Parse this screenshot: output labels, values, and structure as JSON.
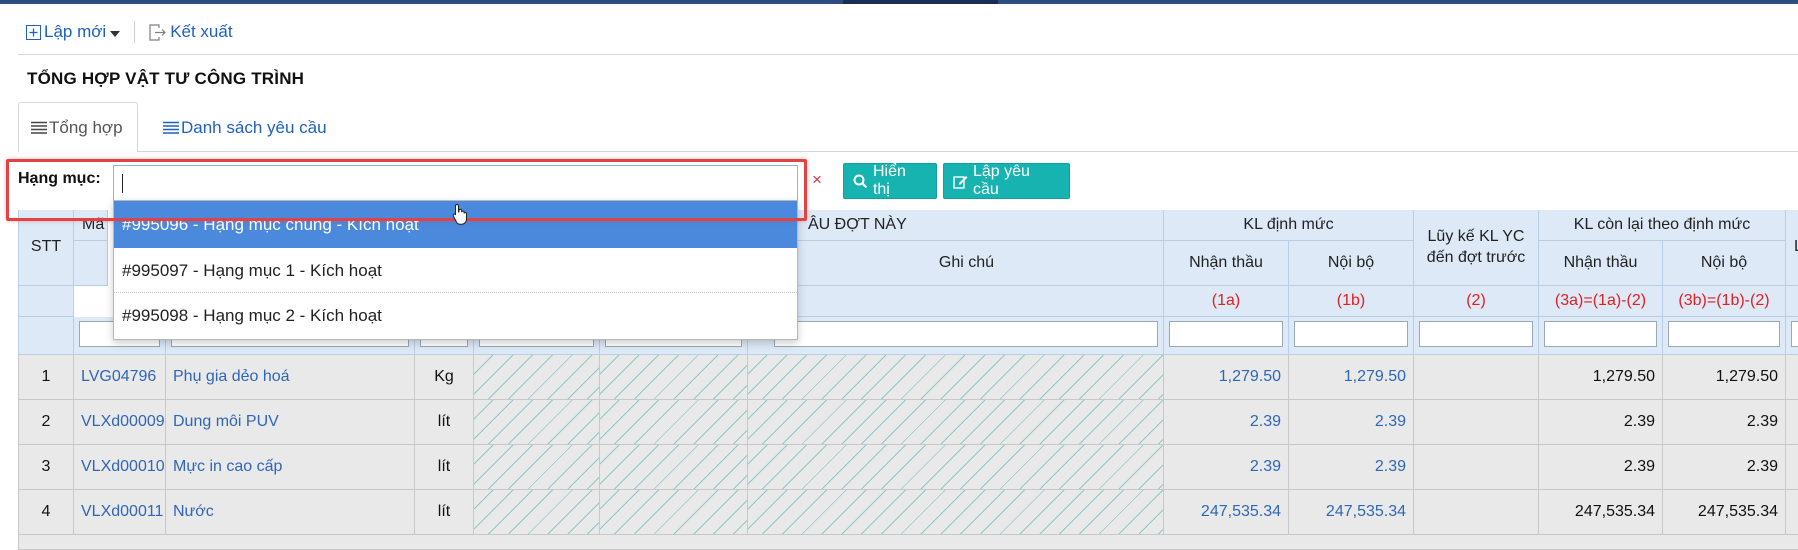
{
  "toolbar": {
    "new_label": "Lập mới",
    "export_label": "Kết xuất"
  },
  "page_title": "TỔNG HỢP VẬT TƯ CÔNG TRÌNH",
  "tabs": [
    {
      "label": "Tổng hợp"
    },
    {
      "label": "Danh sách yêu cầu"
    }
  ],
  "filter": {
    "label": "Hạng mục:",
    "value": "",
    "clear_symbol": "×"
  },
  "buttons": {
    "show": "Hiển thị",
    "create_request": "Lập yêu cầu"
  },
  "dropdown": {
    "options": [
      "#995096 - Hạng mục chung - Kích hoạt",
      "#995097 - Hạng mục 1 - Kích hoạt",
      "#995098 - Hạng mục 2 - Kích hoạt"
    ],
    "selected_index": 0
  },
  "table": {
    "headers": {
      "stt": "STT",
      "ma": "Mã",
      "this_round": "ÂU ĐỢT NÀY",
      "ghi_chu": "Ghi chú",
      "kl_dinh_muc": "KL định mức",
      "nhan_thau": "Nhận thầu",
      "noi_bo": "Nội bộ",
      "luy_ke": "Lũy kế KL YC đến đợt trước",
      "kl_con_lai": "KL còn lại theo định mức",
      "nhan_thau_2": "Nhận thầu",
      "noi_bo_2": "Nội bộ",
      "luy_partial": "Lũ"
    },
    "formulas": {
      "f1a": "(1a)",
      "f1b": "(1b)",
      "f2": "(2)",
      "f3a": "(3a)=(1a)-(2)",
      "f3b": "(3b)=(1b)-(2)"
    },
    "rows": [
      {
        "stt": "1",
        "code": "LVG04796",
        "name": "Phụ gia dẻo hoá",
        "unit": "Kg",
        "nt": "1,279.50",
        "nb": "1,279.50",
        "cl_nt": "1,279.50",
        "cl_nb": "1,279.50"
      },
      {
        "stt": "2",
        "code": "VLXd00009",
        "name": "Dung môi PUV",
        "unit": "lít",
        "nt": "2.39",
        "nb": "2.39",
        "cl_nt": "2.39",
        "cl_nb": "2.39"
      },
      {
        "stt": "3",
        "code": "VLXd00010",
        "name": "Mực in cao cấp",
        "unit": "lít",
        "nt": "2.39",
        "nb": "2.39",
        "cl_nt": "2.39",
        "cl_nb": "2.39"
      },
      {
        "stt": "4",
        "code": "VLXd00011",
        "name": "Nước",
        "unit": "lít",
        "nt": "247,535.34",
        "nb": "247,535.34",
        "cl_nt": "247,535.34",
        "cl_nb": "247,535.34"
      }
    ]
  },
  "colors": {
    "accent": "#17b3b0",
    "link": "#2f66b8",
    "header_bg": "#dde9f7",
    "highlight": "#e04343",
    "selected": "#4a89dc"
  }
}
